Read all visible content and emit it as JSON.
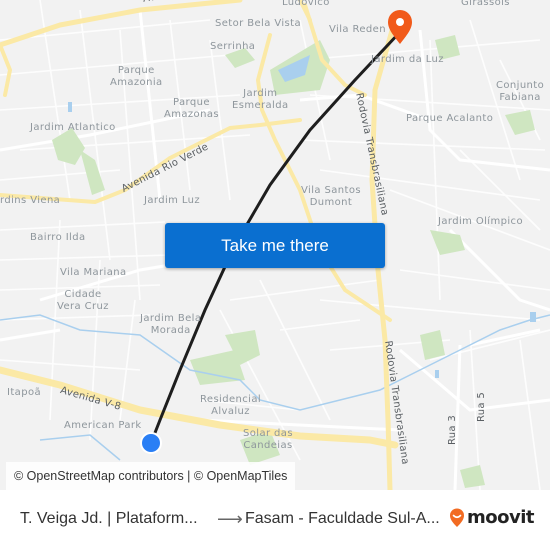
{
  "map": {
    "neighborhoods": [
      {
        "id": "setor-bela-vista",
        "text": "Setor Bela Vista"
      },
      {
        "id": "ludovico",
        "text": "Ludovico"
      },
      {
        "id": "girassois",
        "text": "Girassóis"
      },
      {
        "id": "serrinha",
        "text": "Serrinha"
      },
      {
        "id": "vila-redencao",
        "text": "Vila Reden"
      },
      {
        "id": "parque-amazonia",
        "text": "Parque\nAmazonia"
      },
      {
        "id": "jardim-da-luz",
        "text": "Jardim da Luz"
      },
      {
        "id": "conjunto-fabiana",
        "text": "Conjunto\nFabiana"
      },
      {
        "id": "parque-amazonas",
        "text": "Parque\nAmazonas"
      },
      {
        "id": "jardim-esmeralda",
        "text": "Jardim\nEsmeralda"
      },
      {
        "id": "jardim-atlantico",
        "text": "Jardim Atlantico"
      },
      {
        "id": "parque-acalanto",
        "text": "Parque Acalanto"
      },
      {
        "id": "jardins-viena",
        "text": "rdins Viena"
      },
      {
        "id": "jardim-luz",
        "text": "Jardim Luz"
      },
      {
        "id": "vila-santos-dumont",
        "text": "Vila Santos\nDumont"
      },
      {
        "id": "jardim-olimpico",
        "text": "Jardim Olímpico"
      },
      {
        "id": "bairro-ilda",
        "text": "Bairro Ilda"
      },
      {
        "id": "vila-mariana",
        "text": "Vila Mariana"
      },
      {
        "id": "cidade-vera-cruz",
        "text": "Cidade\nVera Cruz"
      },
      {
        "id": "jardim-bela-morada",
        "text": "Jardim Bela\nMorada"
      },
      {
        "id": "itapoa",
        "text": "Itapoã"
      },
      {
        "id": "residencial-alvaluz",
        "text": "Residencial\nAlvaluz"
      },
      {
        "id": "american-park",
        "text": "American Park"
      },
      {
        "id": "solar-das-candeias",
        "text": "Solar das\nCandeias"
      }
    ],
    "roads": [
      {
        "id": "avenida-top",
        "text": "Avenida Pé"
      },
      {
        "id": "avenida-rio-verde",
        "text": "Avenida Rio Verde"
      },
      {
        "id": "rodovia-transbrasiliana-top",
        "text": "Rodovia Transbrasiliana"
      },
      {
        "id": "rodovia-transbrasiliana-bottom",
        "text": "Rodovia Transbrasiliana"
      },
      {
        "id": "avenida-v8",
        "text": "Avenida V-8"
      },
      {
        "id": "rua-3",
        "text": "Rua 3"
      },
      {
        "id": "rua-5",
        "text": "Rua 5"
      }
    ],
    "colors": {
      "background": "#f2f2f2",
      "major_road": "#fbe9a6",
      "park": "#cfe6c1",
      "water": "#a9cfee",
      "route_line": "#1e1e1e",
      "destination_pin": "#f15a1a",
      "origin_dot": "#2a7ff5"
    },
    "markers": {
      "origin": "origin-dot",
      "destination": "destination-pin"
    }
  },
  "cta": {
    "label": "Take me there"
  },
  "attribution": "© OpenStreetMap contributors | © OpenMapTiles",
  "footer": {
    "from": "T. Veiga Jd. | Plataform...",
    "arrow": "⟶",
    "to": "Fasam - Faculdade Sul-A...",
    "brand": "moovit",
    "brand_color": "#f26b22"
  }
}
